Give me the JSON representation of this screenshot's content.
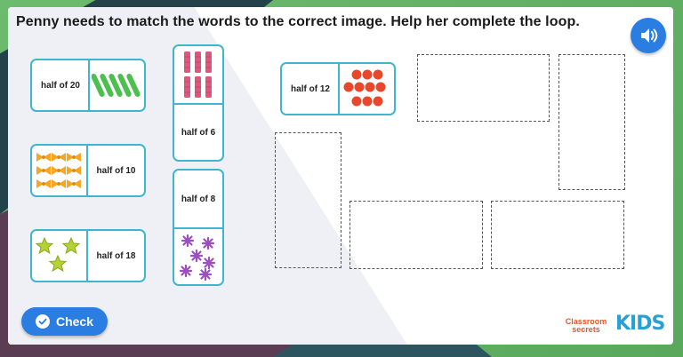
{
  "question": "Penny needs to match the words to the correct image. Help her complete the loop.",
  "audio_button": {
    "icon": "speaker-icon"
  },
  "dominoes": [
    {
      "id": "half-of-20",
      "label": "half of 20",
      "picture": "green-sticks",
      "count": 5,
      "color": "#4cbf4e"
    },
    {
      "id": "half-of-10",
      "label": "half of 10",
      "picture": "orange-bows",
      "count": 9,
      "color": "#f5a623"
    },
    {
      "id": "half-of-18",
      "label": "half of 18",
      "picture": "green-stars",
      "count": 3,
      "color": "#b5d334"
    },
    {
      "id": "half-of-6",
      "label": "half of 6",
      "picture": "pink-bars",
      "count": 6,
      "color": "#e0577d"
    },
    {
      "id": "half-of-8",
      "label": "half of 8",
      "picture": "purple-flowers",
      "count": 6,
      "color": "#9b4fc2"
    },
    {
      "id": "half-of-12",
      "label": "half of 12",
      "picture": "red-dots",
      "count": 10,
      "color": "#e8472b"
    }
  ],
  "check_button": {
    "label": "Check",
    "icon": "check-circle-icon"
  },
  "logo": {
    "line1": "Classroom",
    "line2": "secrets",
    "kids": "KIDS",
    "brand_color": "#e9552a",
    "kids_color": "#2a9fd6"
  },
  "colors": {
    "accent": "#2a7de1",
    "domino_border": "#3fb6cf"
  }
}
